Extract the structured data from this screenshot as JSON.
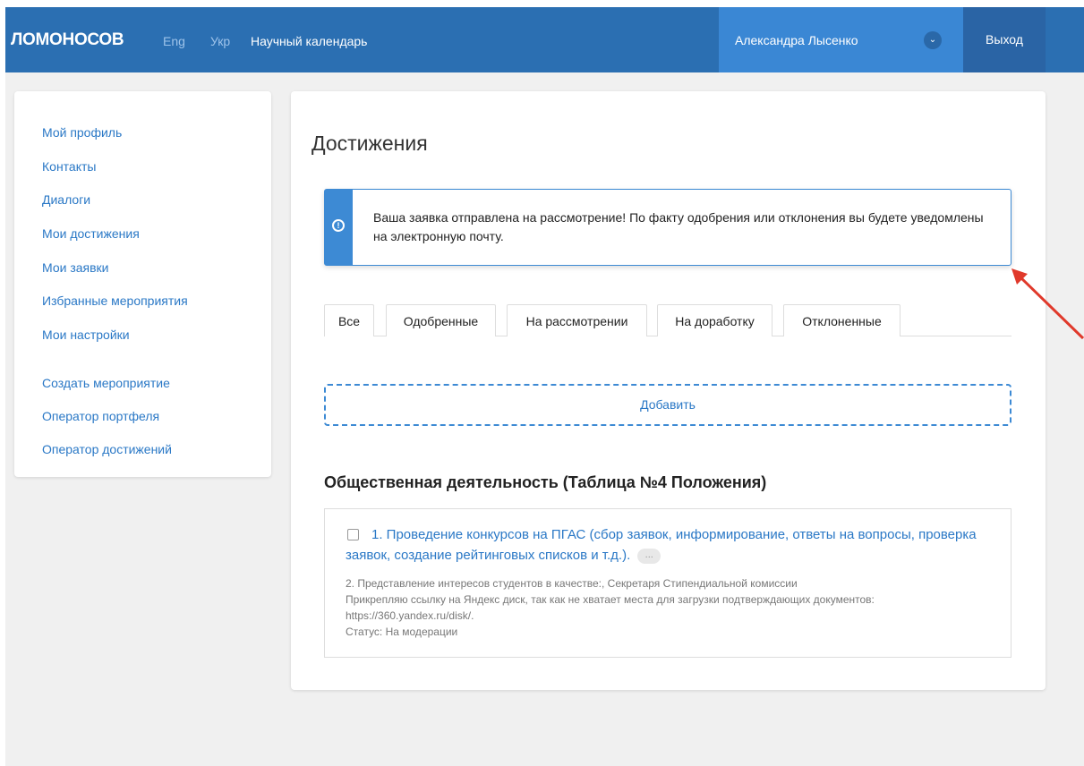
{
  "header": {
    "brand": "ЛОМОНОСОВ",
    "lang_en": "Eng",
    "lang_uk": "Укр",
    "calendar": "Научный календарь",
    "user_name": "Александра Лысенко",
    "logout": "Выход"
  },
  "sidebar": {
    "items": [
      {
        "label": "Мой профиль"
      },
      {
        "label": "Контакты"
      },
      {
        "label": "Диалоги"
      },
      {
        "label": "Мои достижения"
      },
      {
        "label": "Мои заявки"
      },
      {
        "label": "Избранные мероприятия"
      },
      {
        "label": "Мои настройки"
      },
      {
        "label": "Создать мероприятие"
      },
      {
        "label": "Оператор портфеля"
      },
      {
        "label": "Оператор достижений"
      }
    ]
  },
  "main": {
    "title": "Достижения",
    "alert": "Ваша заявка отправлена на рассмотрение! По факту одобрения или отклонения вы будете уведомлены на электронную почту.",
    "tabs": [
      {
        "label": "Все"
      },
      {
        "label": "Одобренные"
      },
      {
        "label": "На рассмотрении"
      },
      {
        "label": "На доработку"
      },
      {
        "label": "Отклоненные"
      }
    ],
    "add_label": "Добавить",
    "section_title": "Общественная деятельность (Таблица №4 Положения)",
    "card": {
      "title": "1. Проведение конкурсов на ПГАС (сбор заявок, информирование, ответы на вопросы, проверка заявок, создание рейтинговых списков и т.д.).",
      "ellipsis": "...",
      "line1": "2. Представление интересов студентов в качестве:, Секретаря Стипендиальной комиссии",
      "line2": "Прикрепляю ссылку на Яндекс диск, так как не хватает места для загрузки подтверждающих документов:",
      "line3": "https://360.yandex.ru/disk/.",
      "status": "Статус: На модерации"
    }
  },
  "colors": {
    "header_bg": "#2b6fb2",
    "accent": "#3d8ad4",
    "link": "#2a78c6",
    "annotation_arrow": "#e0392b"
  }
}
